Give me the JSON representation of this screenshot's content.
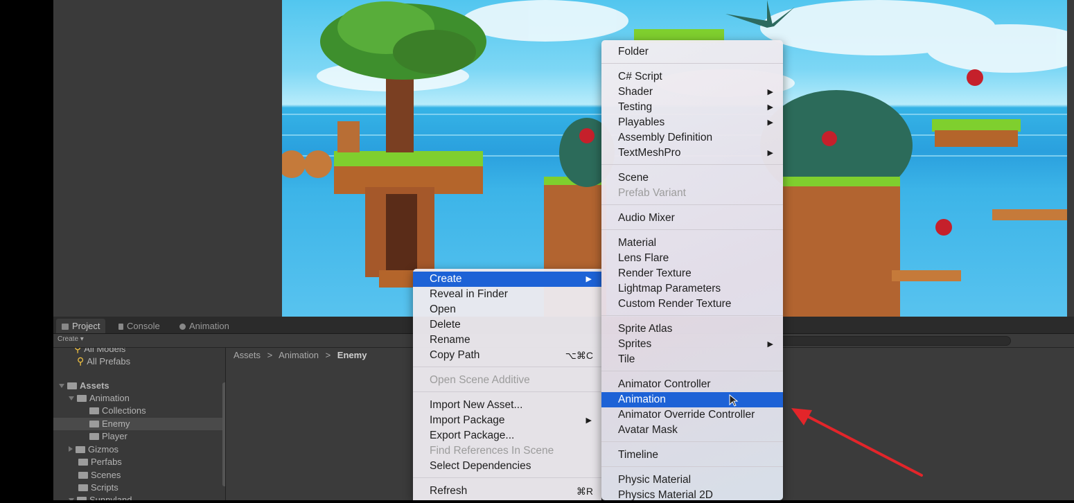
{
  "bottom_panel": {
    "tabs": [
      "Project",
      "Console",
      "Animation"
    ],
    "create_label": "Create ▾",
    "favorites": [
      "All Models",
      "All Prefabs"
    ],
    "tree": {
      "assets": "Assets",
      "animation": "Animation",
      "collections": "Collections",
      "enemy": "Enemy",
      "player": "Player",
      "gizmos": "Gizmos",
      "perfabs": "Perfabs",
      "scenes": "Scenes",
      "scripts": "Scripts",
      "sunnyland": "Sunnyland"
    },
    "breadcrumb": {
      "a": "Assets",
      "sep": ">",
      "b": "Animation",
      "c": "Enemy"
    }
  },
  "context_menu": {
    "create": "Create",
    "reveal": "Reveal in Finder",
    "open": "Open",
    "delete": "Delete",
    "rename": "Rename",
    "copy_path": "Copy Path",
    "copy_path_shortcut": "⌥⌘C",
    "open_scene_additive": "Open Scene Additive",
    "import_new_asset": "Import New Asset...",
    "import_package": "Import Package",
    "export_package": "Export Package...",
    "find_references": "Find References In Scene",
    "select_dependencies": "Select Dependencies",
    "refresh": "Refresh",
    "refresh_shortcut": "⌘R"
  },
  "create_submenu": {
    "folder": "Folder",
    "csharp_script": "C# Script",
    "shader": "Shader",
    "testing": "Testing",
    "playables": "Playables",
    "assembly_definition": "Assembly Definition",
    "textmeshpro": "TextMeshPro",
    "scene": "Scene",
    "prefab_variant": "Prefab Variant",
    "audio_mixer": "Audio Mixer",
    "material": "Material",
    "lens_flare": "Lens Flare",
    "render_texture": "Render Texture",
    "lightmap_parameters": "Lightmap Parameters",
    "custom_render_texture": "Custom Render Texture",
    "sprite_atlas": "Sprite Atlas",
    "sprites": "Sprites",
    "tile": "Tile",
    "animator_controller": "Animator Controller",
    "animation": "Animation",
    "animator_override_controller": "Animator Override Controller",
    "avatar_mask": "Avatar Mask",
    "timeline": "Timeline",
    "physic_material": "Physic Material",
    "physics_material_2d": "Physics Material 2D"
  },
  "colors": {
    "highlight": "#1d62d6",
    "annotation_arrow": "#e3252a"
  }
}
